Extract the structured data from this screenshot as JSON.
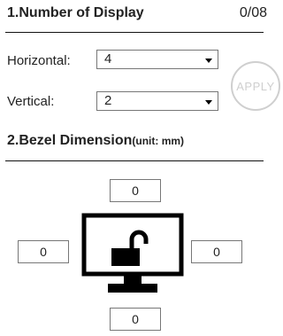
{
  "section1": {
    "title": "1.Number of Display",
    "count": "0/08"
  },
  "horizontal": {
    "label": "Horizontal:",
    "value": "4"
  },
  "vertical": {
    "label": "Vertical:",
    "value": "2"
  },
  "apply": {
    "label": "APPLY"
  },
  "section2": {
    "title": "2.Bezel Dimension",
    "unit": "(unit: mm)"
  },
  "bezel": {
    "top": "0",
    "left": "0",
    "right": "0",
    "bottom": "0"
  },
  "icons": {
    "monitor": "monitor-unlock-icon"
  }
}
